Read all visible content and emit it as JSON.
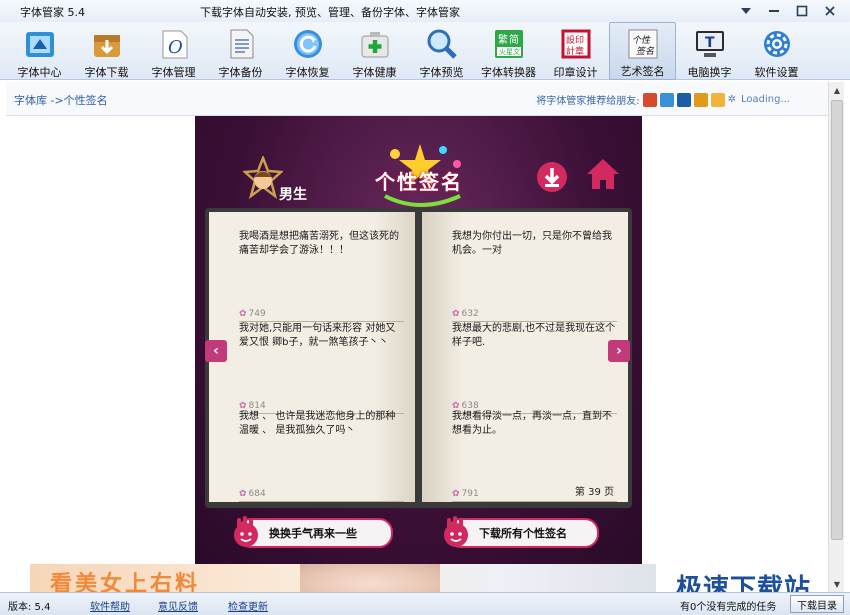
{
  "app": {
    "title": "字体管家 5.4",
    "slogan": "下载字体自动安装, 预览、管理、备份字体、字体管家"
  },
  "toolbar": {
    "items": [
      {
        "label": "字体中心",
        "icon": "font-center-icon"
      },
      {
        "label": "字体下载",
        "icon": "font-download-icon"
      },
      {
        "label": "字体管理",
        "icon": "font-manage-icon"
      },
      {
        "label": "字体备份",
        "icon": "font-backup-icon"
      },
      {
        "label": "字体恢复",
        "icon": "font-restore-icon"
      },
      {
        "label": "字体健康",
        "icon": "font-health-icon"
      },
      {
        "label": "字体预览",
        "icon": "font-preview-icon"
      },
      {
        "label": "字体转换器",
        "icon": "font-converter-icon"
      },
      {
        "label": "印章设计",
        "icon": "seal-design-icon"
      },
      {
        "label": "艺术签名",
        "icon": "art-signature-icon"
      },
      {
        "label": "电脑换字",
        "icon": "computer-font-icon"
      },
      {
        "label": "软件设置",
        "icon": "settings-gear-icon"
      }
    ],
    "active_index": 9
  },
  "breadcrumb": {
    "text": "字体库 ->个性签名"
  },
  "share": {
    "label": "将字体管家推荐给朋友:",
    "loading": "Loading..."
  },
  "signature": {
    "brand": "个性签名",
    "gender": "男生",
    "entries_left": [
      {
        "text": "我喝酒是想把痛苦溺死，但这该死的痛苦却学会了游泳！！！",
        "likes": "749"
      },
      {
        "text": "我对她,只能用一句话来形容 对她又爱又恨   卿b子，就一煞笔孩子丶丶",
        "likes": "814"
      },
      {
        "text": "我想 、 也许是我迷恋他身上的那种温暖 、 是我孤独久了吗丶",
        "likes": "684"
      }
    ],
    "entries_right": [
      {
        "text": "我想为你付出一切，只是你不曾给我机会。一对",
        "likes": "632"
      },
      {
        "text": "我想最大的悲剧,也不过是我现在这个样子吧.",
        "likes": "638"
      },
      {
        "text": "我想看得淡一点，再淡一点，直到不想看为止。",
        "likes": "791"
      }
    ],
    "page": "第 39 页",
    "btn_luck": "换换手气再来一些",
    "btn_download": "下载所有个性签名"
  },
  "ad": {
    "text": "看美女上右料"
  },
  "watermark": "极速下载站",
  "status": {
    "version": "版本: 5.4",
    "help": "软件帮助",
    "feedback": "意见反馈",
    "update": "检查更新",
    "tasks": "有0个没有完成的任务",
    "download_dir": "下载目录"
  },
  "colors": {
    "accent": "#2c5ea8",
    "sig_bg": "#3a0f36",
    "sig_pink": "#d22a5f"
  }
}
